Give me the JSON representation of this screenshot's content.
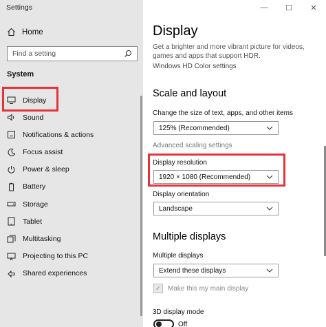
{
  "window": {
    "title": "Settings",
    "controls": {
      "minimize": "—",
      "maximize": "☐",
      "close": "✕"
    }
  },
  "sidebar": {
    "home_label": "Home",
    "search_placeholder": "Find a setting",
    "section": "System",
    "items": [
      {
        "label": "Display",
        "icon": "monitor-icon",
        "active": true
      },
      {
        "label": "Sound",
        "icon": "speaker-icon"
      },
      {
        "label": "Notifications & actions",
        "icon": "notifications-icon"
      },
      {
        "label": "Focus assist",
        "icon": "moon-icon"
      },
      {
        "label": "Power & sleep",
        "icon": "power-icon"
      },
      {
        "label": "Battery",
        "icon": "battery-icon"
      },
      {
        "label": "Storage",
        "icon": "storage-icon"
      },
      {
        "label": "Tablet",
        "icon": "tablet-icon"
      },
      {
        "label": "Multitasking",
        "icon": "multitasking-icon"
      },
      {
        "label": "Projecting to this PC",
        "icon": "projecting-icon"
      },
      {
        "label": "Shared experiences",
        "icon": "shared-icon"
      }
    ]
  },
  "main": {
    "title": "Display",
    "description": "Get a brighter and more vibrant picture for videos, games and apps that support HDR.",
    "hdr_link": "Windows HD Color settings",
    "scale_heading": "Scale and layout",
    "scale_label": "Change the size of text, apps, and other items",
    "scale_value": "125% (Recommended)",
    "advanced_link": "Advanced scaling settings",
    "resolution_label": "Display resolution",
    "resolution_value": "1920 × 1080 (Recommended)",
    "orientation_label": "Display orientation",
    "orientation_value": "Landscape",
    "multi_heading": "Multiple displays",
    "multi_label": "Multiple displays",
    "multi_value": "Extend these displays",
    "main_display_label": "Make this my main display",
    "mode_label": "3D display mode",
    "mode_toggle": "Off"
  },
  "colors": {
    "highlight": "#e5323b",
    "sidebar_bg": "#e6e6e6"
  }
}
